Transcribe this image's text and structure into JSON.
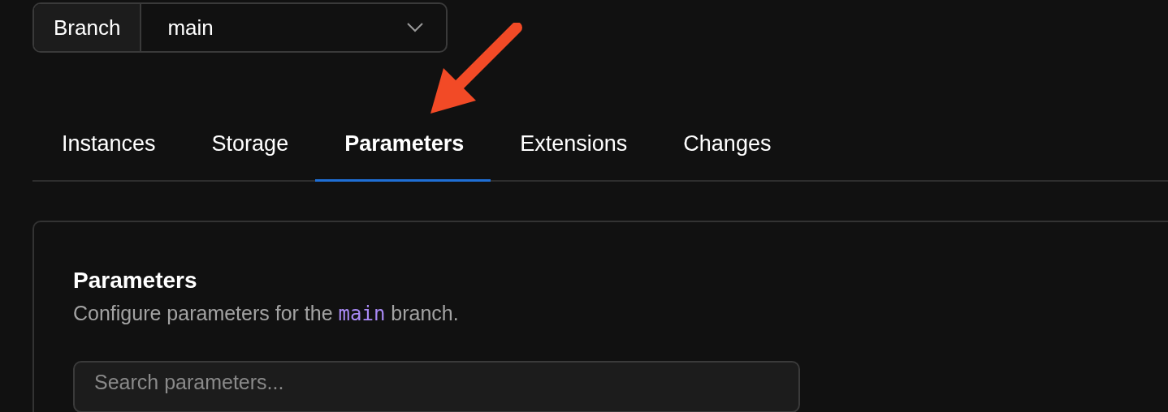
{
  "branch_selector": {
    "label": "Branch",
    "value": "main"
  },
  "tabs": [
    {
      "label": "Instances",
      "selected": false
    },
    {
      "label": "Storage",
      "selected": false
    },
    {
      "label": "Parameters",
      "selected": true
    },
    {
      "label": "Extensions",
      "selected": false
    },
    {
      "label": "Changes",
      "selected": false
    }
  ],
  "card": {
    "title": "Parameters",
    "description_before": "Configure parameters for the",
    "description_code": "main",
    "description_after": "branch.",
    "search": {
      "placeholder": "Search parameters..."
    }
  }
}
